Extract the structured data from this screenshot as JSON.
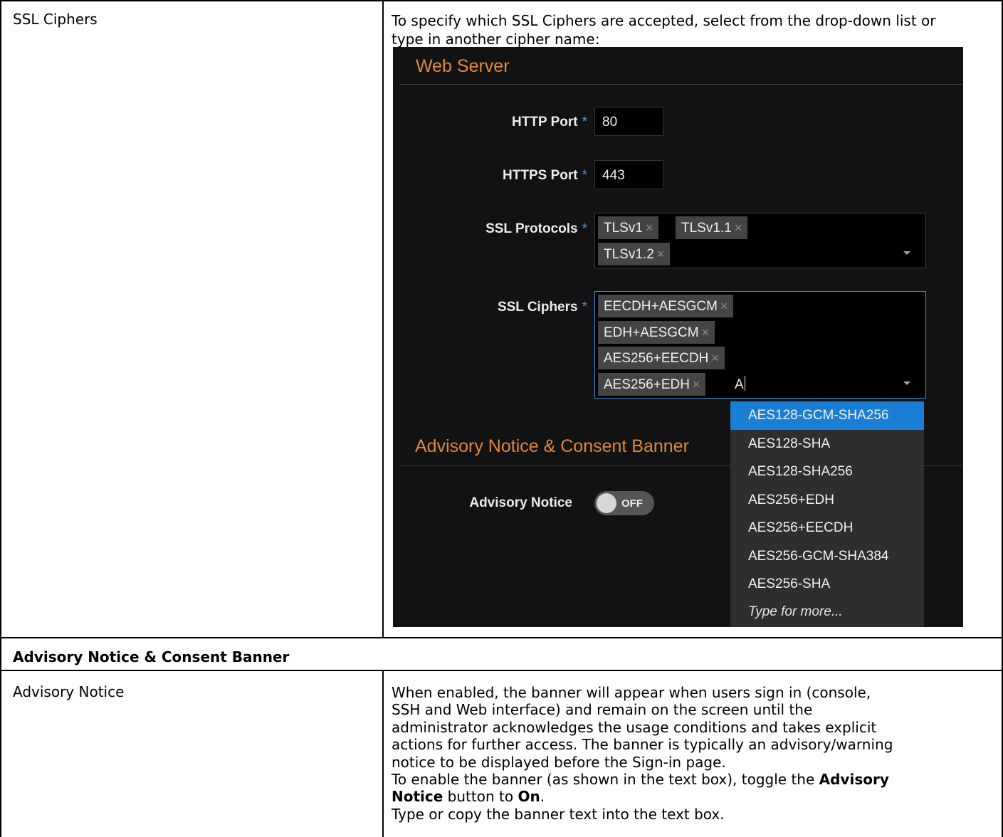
{
  "row_ssl": {
    "param": "SSL Ciphers",
    "desc": "To specify which SSL Ciphers are accepted, select from the drop-down list or type in another cipher name:"
  },
  "screenshot": {
    "web_server_title": "Web Server",
    "http_port_label": "HTTP Port",
    "http_port_value": "80",
    "https_port_label": "HTTPS Port",
    "https_port_value": "443",
    "ssl_protocols_label": "SSL Protocols",
    "ssl_protocols": [
      "TLSv1",
      "TLSv1.1",
      "TLSv1.2"
    ],
    "ssl_ciphers_label": "SSL Ciphers",
    "ssl_ciphers": [
      "EECDH+AESGCM",
      "EDH+AESGCM",
      "AES256+EECDH",
      "AES256+EDH"
    ],
    "typed_text": "A",
    "required_marker": "*",
    "remove_glyph": "×",
    "dropdown_options": [
      "AES128-GCM-SHA256",
      "AES128-SHA",
      "AES128-SHA256",
      "AES256+EDH",
      "AES256+EECDH",
      "AES256-GCM-SHA384",
      "AES256-SHA"
    ],
    "dropdown_more": "Type for more...",
    "advisory_title": "Advisory Notice & Consent Banner",
    "advisory_notice_label": "Advisory Notice",
    "toggle_state": "OFF",
    "colors": {
      "section_title": "#e0883a",
      "highlight": "#1a7fd4",
      "required": "#4a90d9"
    }
  },
  "section_header": "Advisory Notice & Consent Banner",
  "row_advisory": {
    "param": "Advisory Notice",
    "desc_lines": [
      "When enabled, the banner will appear when users sign in (console,",
      "SSH and Web interface) and remain on the screen until the",
      "administrator acknowledges the usage conditions and takes explicit",
      "actions for further access. The banner is typically an advisory/warning",
      "notice to be displayed before the Sign-in page."
    ],
    "enable_prefix": "To enable the banner (as shown in the text box), toggle the ",
    "enable_bold1": "Advisory",
    "enable_bold2": "Notice",
    "enable_mid": " button to ",
    "enable_bold3": "On",
    "enable_end": ".",
    "last_line": "Type or copy the banner text into the text box."
  }
}
